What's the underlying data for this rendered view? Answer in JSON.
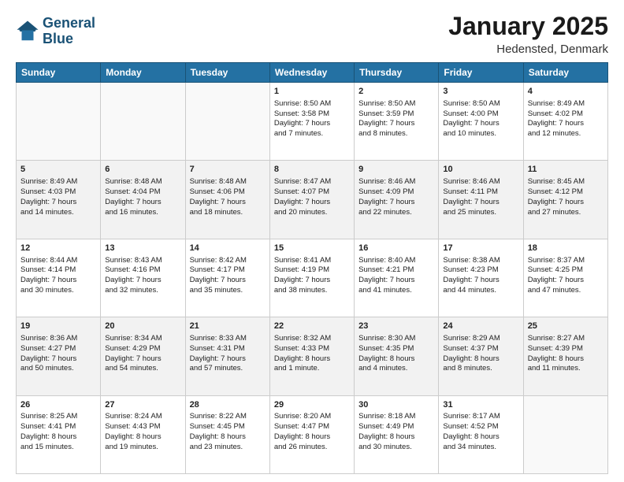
{
  "header": {
    "logo_line1": "General",
    "logo_line2": "Blue",
    "month": "January 2025",
    "location": "Hedensted, Denmark"
  },
  "weekdays": [
    "Sunday",
    "Monday",
    "Tuesday",
    "Wednesday",
    "Thursday",
    "Friday",
    "Saturday"
  ],
  "weeks": [
    [
      {
        "day": "",
        "content": ""
      },
      {
        "day": "",
        "content": ""
      },
      {
        "day": "",
        "content": ""
      },
      {
        "day": "1",
        "content": "Sunrise: 8:50 AM\nSunset: 3:58 PM\nDaylight: 7 hours\nand 7 minutes."
      },
      {
        "day": "2",
        "content": "Sunrise: 8:50 AM\nSunset: 3:59 PM\nDaylight: 7 hours\nand 8 minutes."
      },
      {
        "day": "3",
        "content": "Sunrise: 8:50 AM\nSunset: 4:00 PM\nDaylight: 7 hours\nand 10 minutes."
      },
      {
        "day": "4",
        "content": "Sunrise: 8:49 AM\nSunset: 4:02 PM\nDaylight: 7 hours\nand 12 minutes."
      }
    ],
    [
      {
        "day": "5",
        "content": "Sunrise: 8:49 AM\nSunset: 4:03 PM\nDaylight: 7 hours\nand 14 minutes."
      },
      {
        "day": "6",
        "content": "Sunrise: 8:48 AM\nSunset: 4:04 PM\nDaylight: 7 hours\nand 16 minutes."
      },
      {
        "day": "7",
        "content": "Sunrise: 8:48 AM\nSunset: 4:06 PM\nDaylight: 7 hours\nand 18 minutes."
      },
      {
        "day": "8",
        "content": "Sunrise: 8:47 AM\nSunset: 4:07 PM\nDaylight: 7 hours\nand 20 minutes."
      },
      {
        "day": "9",
        "content": "Sunrise: 8:46 AM\nSunset: 4:09 PM\nDaylight: 7 hours\nand 22 minutes."
      },
      {
        "day": "10",
        "content": "Sunrise: 8:46 AM\nSunset: 4:11 PM\nDaylight: 7 hours\nand 25 minutes."
      },
      {
        "day": "11",
        "content": "Sunrise: 8:45 AM\nSunset: 4:12 PM\nDaylight: 7 hours\nand 27 minutes."
      }
    ],
    [
      {
        "day": "12",
        "content": "Sunrise: 8:44 AM\nSunset: 4:14 PM\nDaylight: 7 hours\nand 30 minutes."
      },
      {
        "day": "13",
        "content": "Sunrise: 8:43 AM\nSunset: 4:16 PM\nDaylight: 7 hours\nand 32 minutes."
      },
      {
        "day": "14",
        "content": "Sunrise: 8:42 AM\nSunset: 4:17 PM\nDaylight: 7 hours\nand 35 minutes."
      },
      {
        "day": "15",
        "content": "Sunrise: 8:41 AM\nSunset: 4:19 PM\nDaylight: 7 hours\nand 38 minutes."
      },
      {
        "day": "16",
        "content": "Sunrise: 8:40 AM\nSunset: 4:21 PM\nDaylight: 7 hours\nand 41 minutes."
      },
      {
        "day": "17",
        "content": "Sunrise: 8:38 AM\nSunset: 4:23 PM\nDaylight: 7 hours\nand 44 minutes."
      },
      {
        "day": "18",
        "content": "Sunrise: 8:37 AM\nSunset: 4:25 PM\nDaylight: 7 hours\nand 47 minutes."
      }
    ],
    [
      {
        "day": "19",
        "content": "Sunrise: 8:36 AM\nSunset: 4:27 PM\nDaylight: 7 hours\nand 50 minutes."
      },
      {
        "day": "20",
        "content": "Sunrise: 8:34 AM\nSunset: 4:29 PM\nDaylight: 7 hours\nand 54 minutes."
      },
      {
        "day": "21",
        "content": "Sunrise: 8:33 AM\nSunset: 4:31 PM\nDaylight: 7 hours\nand 57 minutes."
      },
      {
        "day": "22",
        "content": "Sunrise: 8:32 AM\nSunset: 4:33 PM\nDaylight: 8 hours\nand 1 minute."
      },
      {
        "day": "23",
        "content": "Sunrise: 8:30 AM\nSunset: 4:35 PM\nDaylight: 8 hours\nand 4 minutes."
      },
      {
        "day": "24",
        "content": "Sunrise: 8:29 AM\nSunset: 4:37 PM\nDaylight: 8 hours\nand 8 minutes."
      },
      {
        "day": "25",
        "content": "Sunrise: 8:27 AM\nSunset: 4:39 PM\nDaylight: 8 hours\nand 11 minutes."
      }
    ],
    [
      {
        "day": "26",
        "content": "Sunrise: 8:25 AM\nSunset: 4:41 PM\nDaylight: 8 hours\nand 15 minutes."
      },
      {
        "day": "27",
        "content": "Sunrise: 8:24 AM\nSunset: 4:43 PM\nDaylight: 8 hours\nand 19 minutes."
      },
      {
        "day": "28",
        "content": "Sunrise: 8:22 AM\nSunset: 4:45 PM\nDaylight: 8 hours\nand 23 minutes."
      },
      {
        "day": "29",
        "content": "Sunrise: 8:20 AM\nSunset: 4:47 PM\nDaylight: 8 hours\nand 26 minutes."
      },
      {
        "day": "30",
        "content": "Sunrise: 8:18 AM\nSunset: 4:49 PM\nDaylight: 8 hours\nand 30 minutes."
      },
      {
        "day": "31",
        "content": "Sunrise: 8:17 AM\nSunset: 4:52 PM\nDaylight: 8 hours\nand 34 minutes."
      },
      {
        "day": "",
        "content": ""
      }
    ]
  ]
}
